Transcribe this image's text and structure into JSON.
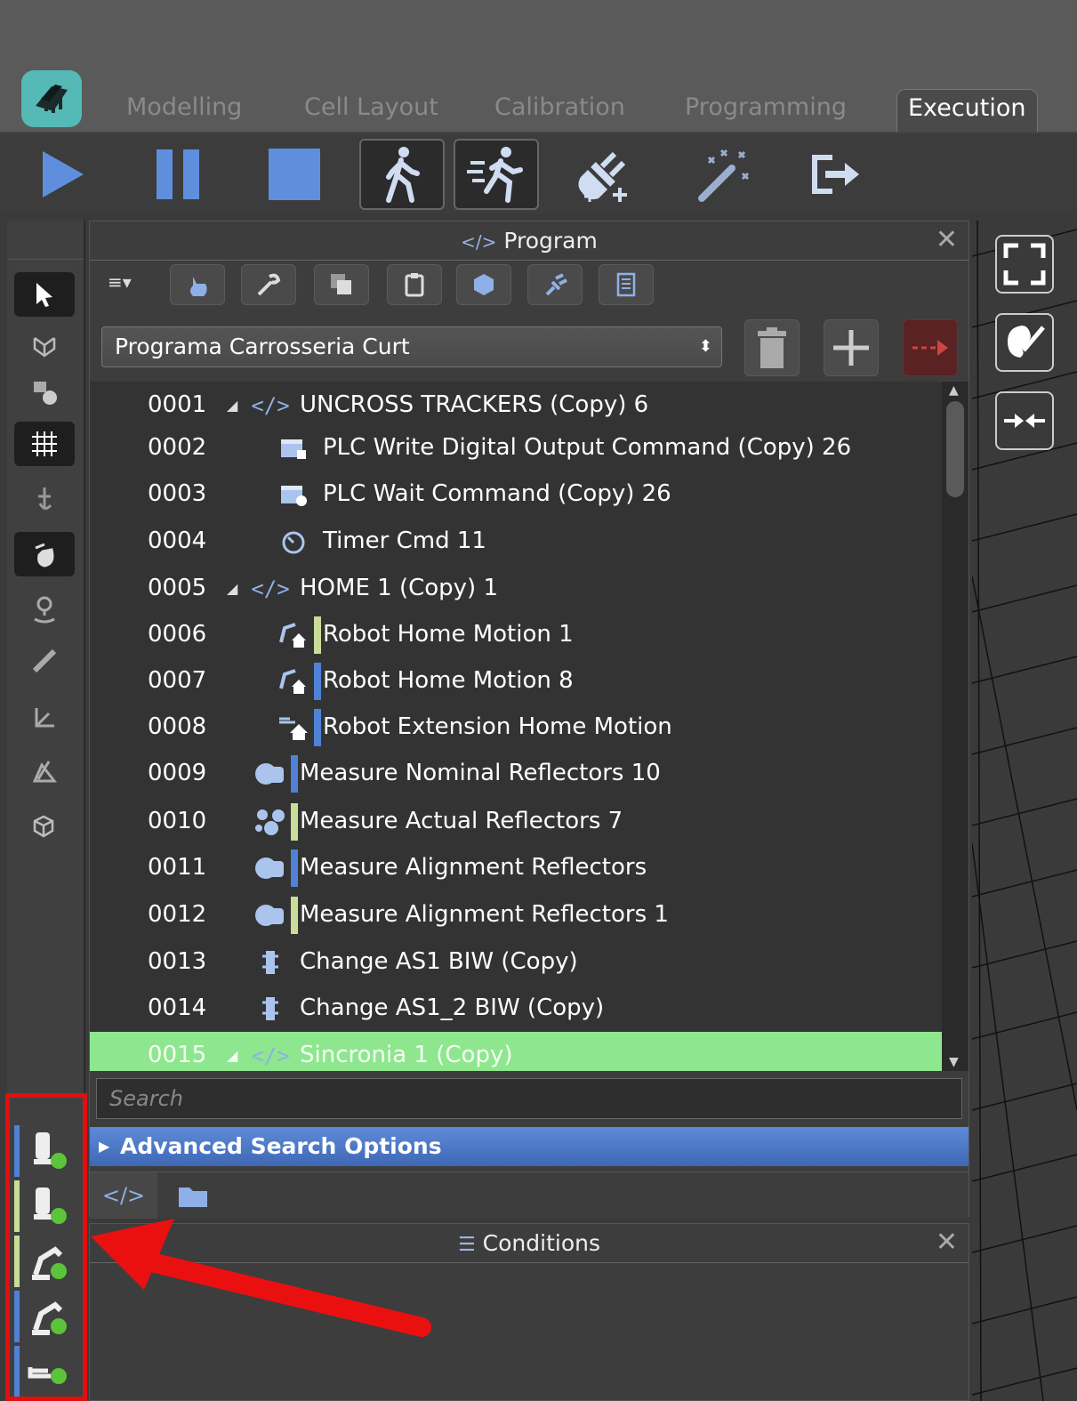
{
  "tabs": [
    {
      "label": "Modelling",
      "active": false
    },
    {
      "label": "Cell Layout",
      "active": false
    },
    {
      "label": "Calibration",
      "active": false
    },
    {
      "label": "Programming",
      "active": false
    },
    {
      "label": "Execution",
      "active": true
    }
  ],
  "toolbar": {
    "buttons": [
      "play-icon",
      "pause-icon",
      "stop-icon",
      "walk-icon",
      "run-icon",
      "plug-add-icon",
      "magic-wand-icon",
      "exit-icon"
    ]
  },
  "program_panel": {
    "title": "Program",
    "title_icon": "code-icon",
    "menu_glyph": "≡▾",
    "selected_program": "Programa Carrosseria Curt",
    "search_placeholder": "Search",
    "advanced_search_label": "Advanced Search Options",
    "rows": [
      {
        "num": "0001",
        "expandable": true,
        "icon": "code-icon",
        "label": "UNCROSS TRACKERS (Copy) 6"
      },
      {
        "num": "0002",
        "expandable": false,
        "icon": "plc-write-icon",
        "label": "PLC Write Digital Output Command (Copy) 26"
      },
      {
        "num": "0003",
        "expandable": false,
        "icon": "plc-wait-icon",
        "label": "PLC Wait Command (Copy) 26"
      },
      {
        "num": "0004",
        "expandable": false,
        "icon": "timer-icon",
        "label": "Timer Cmd 11"
      },
      {
        "num": "0005",
        "expandable": true,
        "icon": "code-icon",
        "label": "HOME 1 (Copy) 1"
      },
      {
        "num": "0006",
        "expandable": false,
        "icon": "robot-home-icon",
        "bar": "#c9dd96",
        "label": "Robot Home Motion 1"
      },
      {
        "num": "0007",
        "expandable": false,
        "icon": "robot-home-icon",
        "bar": "#4f82d6",
        "label": "Robot Home Motion 8"
      },
      {
        "num": "0008",
        "expandable": false,
        "icon": "extension-home-icon",
        "bar": "#4f82d6",
        "label": "Robot Extension Home Motion"
      },
      {
        "num": "0009",
        "expandable": false,
        "icon": "tracker-icon",
        "bar": "#4f82d6",
        "label": "Measure Nominal Reflectors 10"
      },
      {
        "num": "0010",
        "expandable": false,
        "icon": "reflectors-icon",
        "bar": "#c9dd96",
        "label": "Measure Actual Reflectors 7"
      },
      {
        "num": "0011",
        "expandable": false,
        "icon": "tracker-icon",
        "bar": "#4f82d6",
        "label": "Measure Alignment Reflectors"
      },
      {
        "num": "0012",
        "expandable": false,
        "icon": "tracker-icon",
        "bar": "#c9dd96",
        "label": "Measure Alignment Reflectors 1"
      },
      {
        "num": "0013",
        "expandable": false,
        "icon": "change-tool-icon",
        "label": "Change AS1 BIW (Copy)"
      },
      {
        "num": "0014",
        "expandable": false,
        "icon": "change-tool-icon",
        "label": "Change AS1_2 BIW (Copy)"
      },
      {
        "num": "0015",
        "expandable": true,
        "icon": "code-icon",
        "label": "Sincronia 1 (Copy)",
        "highlighted": true
      }
    ]
  },
  "conditions_panel": {
    "title": "Conditions",
    "title_icon": "list-icon"
  },
  "colors": {
    "accent_blue": "#4f82d6",
    "accent_green": "#c9dd96",
    "highlight_row": "#8ee78e",
    "annotation_red": "#e01010",
    "logo": "#55b9b5"
  }
}
